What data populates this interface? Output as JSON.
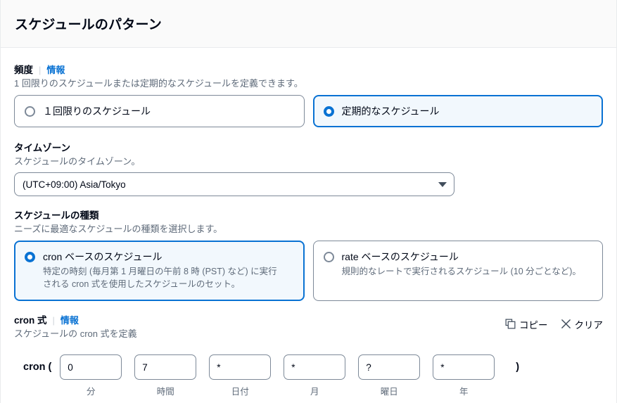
{
  "header": {
    "title": "スケジュールのパターン"
  },
  "frequency": {
    "label": "頻度",
    "info_label": "情報",
    "description": "1 回限りのスケジュールまたは定期的なスケジュールを定義できます。",
    "options": [
      {
        "label": "１回限りのスケジュール",
        "selected": false
      },
      {
        "label": "定期的なスケジュール",
        "selected": true
      }
    ]
  },
  "timezone": {
    "label": "タイムゾーン",
    "description": "スケジュールのタイムゾーン。",
    "selected_value": "(UTC+09:00) Asia/Tokyo",
    "caret_icon": "chevron-down-icon"
  },
  "schedule_type": {
    "label": "スケジュールの種類",
    "description": "ニーズに最適なスケジュールの種類を選択します。",
    "options": [
      {
        "title": "cron ベースのスケジュール",
        "description": "特定の時刻 (毎月第 1 月曜日の午前 8 時 (PST) など) に実行される cron 式を使用したスケジュールのセット。",
        "selected": true
      },
      {
        "title": "rate ベースのスケジュール",
        "description": "規則的なレートで実行されるスケジュール (10 分ごとなど)。",
        "selected": false
      }
    ]
  },
  "cron_expression": {
    "label": "cron 式",
    "info_label": "情報",
    "description": "スケジュールの cron 式を定義",
    "actions": [
      {
        "label": "コピー",
        "icon": "copy-icon"
      },
      {
        "label": "クリア",
        "icon": "close-icon"
      }
    ],
    "prefix": "cron (",
    "suffix": ")",
    "fields": [
      {
        "value": "0",
        "sublabel": "分"
      },
      {
        "value": "7",
        "sublabel": "時間"
      },
      {
        "value": "*",
        "sublabel": "日付"
      },
      {
        "value": "*",
        "sublabel": "月"
      },
      {
        "value": "?",
        "sublabel": "曜日"
      },
      {
        "value": "*",
        "sublabel": "年"
      }
    ]
  },
  "colors": {
    "accent": "#0972d3",
    "selected_bg": "#f2f8fd",
    "border": "#7d8998",
    "text": "#000716",
    "muted": "#5f6b7a",
    "header_bg": "#fafafa"
  }
}
